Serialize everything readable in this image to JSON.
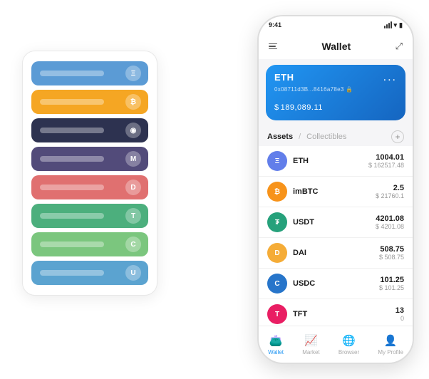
{
  "phone": {
    "status": {
      "time": "9:41",
      "signal": "signal",
      "wifi": "wifi",
      "battery": "battery"
    },
    "header": {
      "menu_icon": "menu-icon",
      "title": "Wallet",
      "expand_icon": "expand-icon"
    },
    "eth_card": {
      "name": "ETH",
      "dots": "...",
      "address": "0x08711d3B...8416a78e3 🔒",
      "balance_prefix": "$",
      "balance": "189,089.11"
    },
    "assets_section": {
      "tab_active": "Assets",
      "divider": "/",
      "tab_inactive": "Collectibles",
      "add_icon": "+"
    },
    "assets": [
      {
        "name": "ETH",
        "color": "#627EEA",
        "letter": "Ξ",
        "amount": "1004.01",
        "usd": "$ 162517.48"
      },
      {
        "name": "imBTC",
        "color": "#F7931A",
        "letter": "₿",
        "amount": "2.5",
        "usd": "$ 21760.1"
      },
      {
        "name": "USDT",
        "color": "#26A17B",
        "letter": "₮",
        "amount": "4201.08",
        "usd": "$ 4201.08"
      },
      {
        "name": "DAI",
        "color": "#F5AC37",
        "letter": "D",
        "amount": "508.75",
        "usd": "$ 508.75"
      },
      {
        "name": "USDC",
        "color": "#2775CA",
        "letter": "C",
        "amount": "101.25",
        "usd": "$ 101.25"
      },
      {
        "name": "TFT",
        "color": "#E91E63",
        "letter": "T",
        "amount": "13",
        "usd": "0"
      }
    ],
    "nav": [
      {
        "label": "Wallet",
        "active": true
      },
      {
        "label": "Market",
        "active": false
      },
      {
        "label": "Browser",
        "active": false
      },
      {
        "label": "My Profile",
        "active": false
      }
    ]
  },
  "card_stack": {
    "cards": [
      {
        "color": "#5B9BD5",
        "icon_letter": "Ξ"
      },
      {
        "color": "#F5A623",
        "icon_letter": "₿"
      },
      {
        "color": "#2D3250",
        "icon_letter": "◉"
      },
      {
        "color": "#524B7A",
        "icon_letter": "M"
      },
      {
        "color": "#E07070",
        "icon_letter": "D"
      },
      {
        "color": "#4CAF7D",
        "icon_letter": "T"
      },
      {
        "color": "#7BC67E",
        "icon_letter": "C"
      },
      {
        "color": "#5BA3D0",
        "icon_letter": "U"
      }
    ]
  }
}
